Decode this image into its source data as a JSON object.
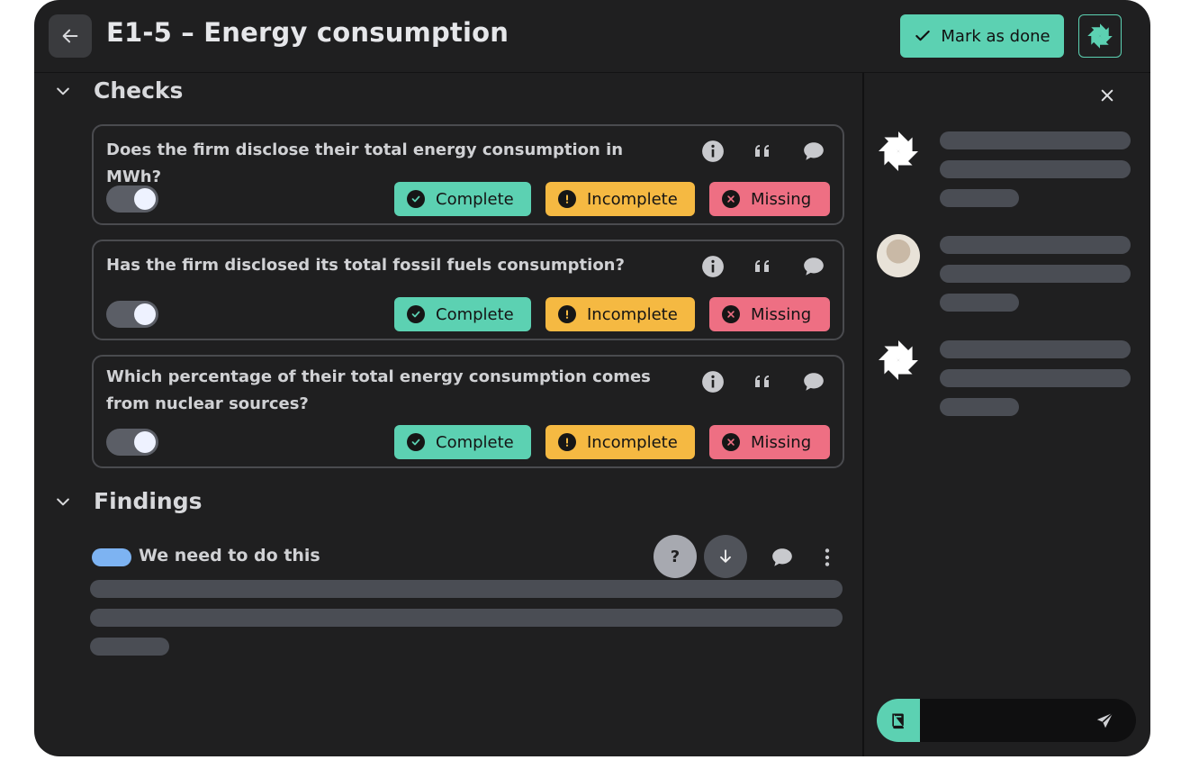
{
  "header": {
    "title": "E1-5 – Energy consumption",
    "mark_done_label": "Mark as done",
    "back_icon": "arrow-left-icon",
    "logo_icon": "pinwheel-logo-icon"
  },
  "colors": {
    "background": "#1f1f20",
    "accent": "#5cd1b2",
    "warning": "#f5b942",
    "danger": "#ee6f83",
    "tag_blue": "#7db3f2"
  },
  "checks": {
    "section_label": "Checks",
    "status_labels": {
      "complete": "Complete",
      "incomplete": "Incomplete",
      "missing": "Missing"
    },
    "items": [
      {
        "question": "Does the firm disclose their total energy consumption in MWh?",
        "enabled": true
      },
      {
        "question": "Has the firm disclosed its total fossil fuels consumption?",
        "enabled": true
      },
      {
        "question": "Which percentage of their total energy consumption comes from nuclear sources?",
        "enabled": true
      }
    ],
    "item_icons": [
      "info-icon",
      "quote-icon",
      "comment-icon"
    ]
  },
  "findings": {
    "section_label": "Findings",
    "items": [
      {
        "label": "We need to do this",
        "help_label": "?"
      }
    ]
  },
  "side_panel": {
    "composer_placeholder": "",
    "icons": [
      "close-icon",
      "book-icon",
      "send-icon"
    ]
  }
}
